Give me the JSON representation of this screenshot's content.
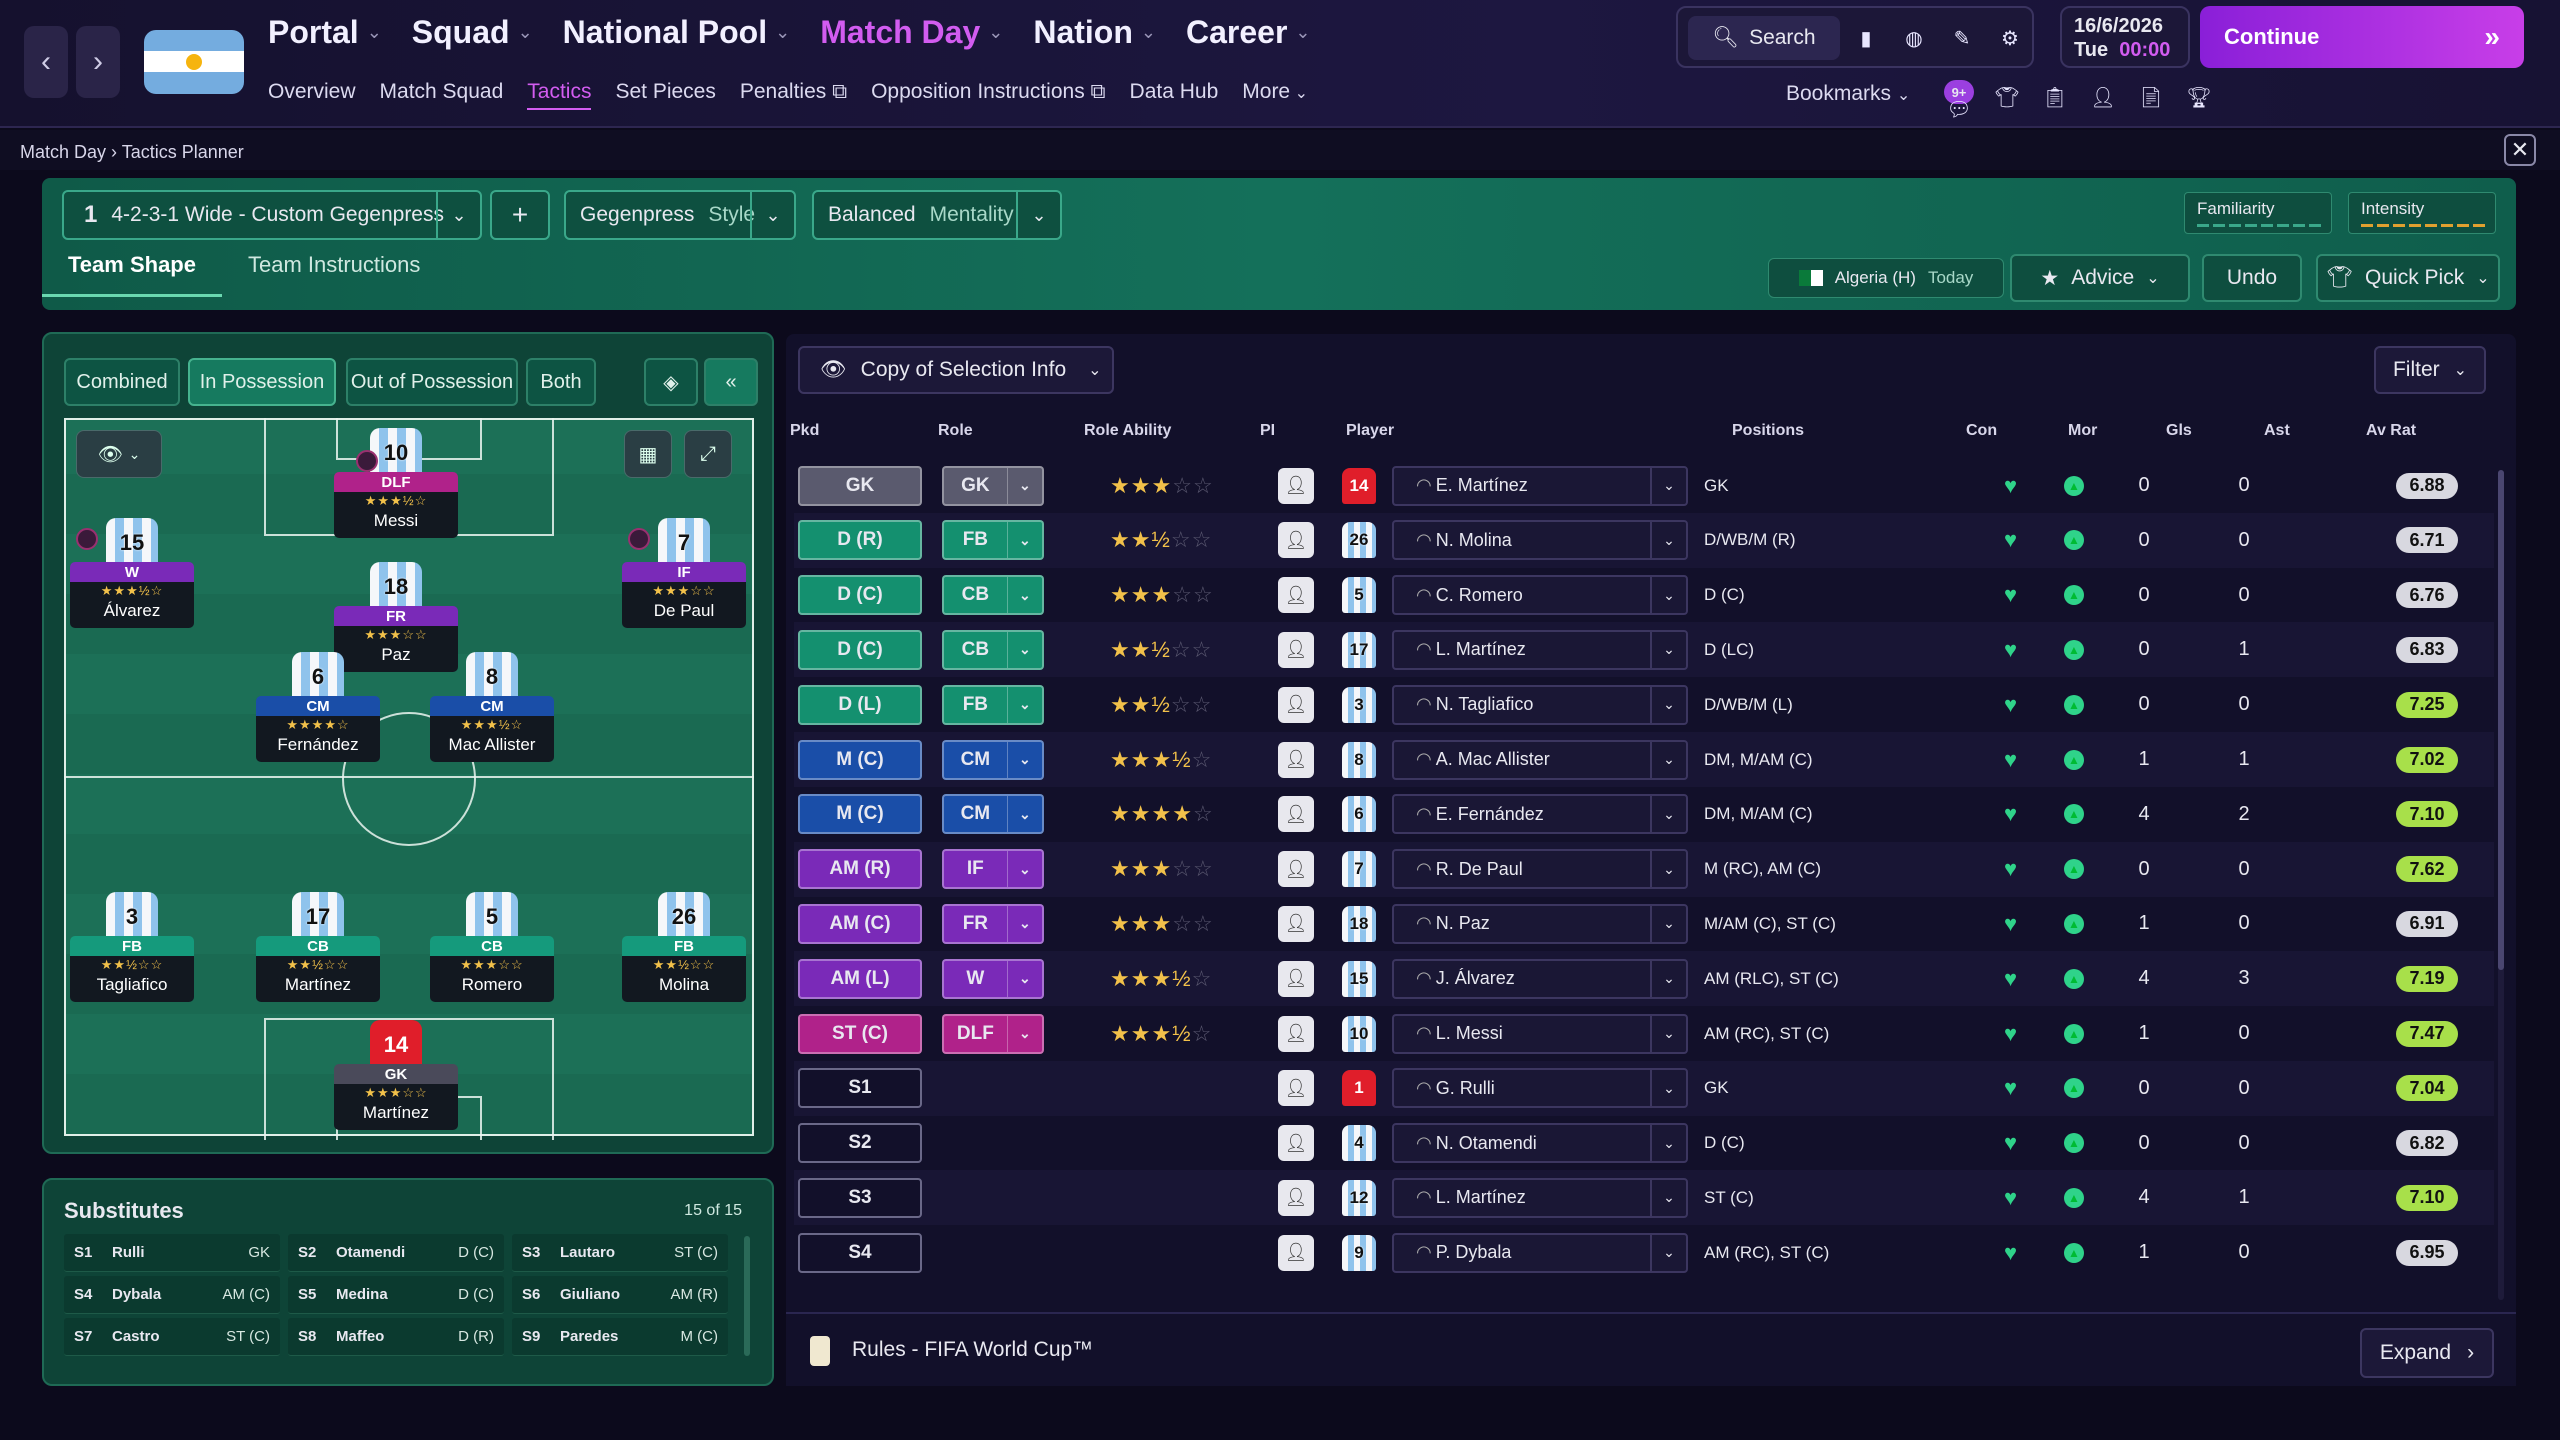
{
  "nav": {
    "back_icon": "chevron-left-icon",
    "forward_icon": "chevron-right-icon",
    "main": [
      {
        "label": "Portal",
        "active": false
      },
      {
        "label": "Squad",
        "active": false
      },
      {
        "label": "National Pool",
        "active": false
      },
      {
        "label": "Match Day",
        "active": true
      },
      {
        "label": "Nation",
        "active": false
      },
      {
        "label": "Career",
        "active": false
      }
    ],
    "sub": [
      "Overview",
      "Match Squad",
      "Tactics",
      "Set Pieces",
      "Penalties",
      "Opposition Instructions",
      "Data Hub",
      "More"
    ],
    "sub_active": "Tactics"
  },
  "toolbar": {
    "search_label": "Search",
    "date": "16/6/2026",
    "day": "Tue",
    "time": "00:00",
    "continue_label": "Continue",
    "bookmarks_label": "Bookmarks",
    "notification_count": "9+"
  },
  "breadcrumb": {
    "parent": "Match Day",
    "current": "Tactics Planner"
  },
  "tactic": {
    "slot": "1",
    "name": "4-2-3-1 Wide - Custom Gegenpress",
    "add_label": "+",
    "style_value": "Gegenpress",
    "style_label": "Style",
    "mentality_value": "Balanced",
    "mentality_label": "Mentality",
    "familiarity_label": "Familiarity",
    "intensity_label": "Intensity"
  },
  "tabs": {
    "team_shape": "Team Shape",
    "team_instructions": "Team Instructions"
  },
  "opponent": {
    "name": "Algeria (H)",
    "when": "Today"
  },
  "actions": {
    "advice": "Advice",
    "undo": "Undo",
    "quick_pick": "Quick Pick"
  },
  "pitch_tabs": [
    "Combined",
    "In Possession",
    "Out of Possession",
    "Both"
  ],
  "pitch_tab_active": "In Possession",
  "pitch_players": [
    {
      "num": "10",
      "role": "DLF",
      "stars": "★★★½☆",
      "name": "Messi",
      "color": "#b0228a",
      "gk": false
    },
    {
      "num": "15",
      "role": "W",
      "stars": "★★★½☆",
      "name": "Álvarez",
      "color": "#7a2ab8",
      "gk": false
    },
    {
      "num": "7",
      "role": "IF",
      "stars": "★★★☆☆",
      "name": "De Paul",
      "color": "#7a2ab8",
      "gk": false
    },
    {
      "num": "18",
      "role": "FR",
      "stars": "★★★☆☆",
      "name": "Paz",
      "color": "#7a2ab8",
      "gk": false
    },
    {
      "num": "6",
      "role": "CM",
      "stars": "★★★★☆",
      "name": "Fernández",
      "color": "#1a4ea8",
      "gk": false
    },
    {
      "num": "8",
      "role": "CM",
      "stars": "★★★½☆",
      "name": "Mac Allister",
      "color": "#1a4ea8",
      "gk": false
    },
    {
      "num": "3",
      "role": "FB",
      "stars": "★★½☆☆",
      "name": "Tagliafico",
      "color": "#159a7c",
      "gk": false
    },
    {
      "num": "17",
      "role": "CB",
      "stars": "★★½☆☆",
      "name": "Martínez",
      "color": "#159a7c",
      "gk": false
    },
    {
      "num": "5",
      "role": "CB",
      "stars": "★★★☆☆",
      "name": "Romero",
      "color": "#159a7c",
      "gk": false
    },
    {
      "num": "26",
      "role": "FB",
      "stars": "★★½☆☆",
      "name": "Molina",
      "color": "#159a7c",
      "gk": false
    },
    {
      "num": "14",
      "role": "GK",
      "stars": "★★★☆☆",
      "name": "Martínez",
      "color": "#4a4a5a",
      "gk": true
    }
  ],
  "substitutes": {
    "title": "Substitutes",
    "count": "15 of 15",
    "items": [
      {
        "slot": "S1",
        "name": "Rulli",
        "pos": "GK"
      },
      {
        "slot": "S2",
        "name": "Otamendi",
        "pos": "D (C)"
      },
      {
        "slot": "S3",
        "name": "Lautaro",
        "pos": "ST (C)"
      },
      {
        "slot": "S4",
        "name": "Dybala",
        "pos": "AM (C)"
      },
      {
        "slot": "S5",
        "name": "Medina",
        "pos": "D (C)"
      },
      {
        "slot": "S6",
        "name": "Giuliano",
        "pos": "AM (R)"
      },
      {
        "slot": "S7",
        "name": "Castro",
        "pos": "ST (C)"
      },
      {
        "slot": "S8",
        "name": "Maffeo",
        "pos": "D (R)"
      },
      {
        "slot": "S9",
        "name": "Paredes",
        "pos": "M (C)"
      }
    ]
  },
  "table": {
    "copy_label": "Copy of Selection Info",
    "filter_label": "Filter",
    "headers": [
      "Pkd",
      "Role",
      "Role Ability",
      "PI",
      "Player",
      "Positions",
      "Con",
      "Mor",
      "Gls",
      "Ast",
      "Av Rat"
    ],
    "rows": [
      {
        "pkd": "GK",
        "role": "GK",
        "stars": "★★★☆☆",
        "num": "14",
        "gk": true,
        "player": "E. Martínez",
        "positions": "GK",
        "gls": "0",
        "ast": "0",
        "rat": "6.88",
        "color": "#5a5a6e",
        "ratcolor": "#d8d8e0"
      },
      {
        "pkd": "D (R)",
        "role": "FB",
        "stars": "★★½☆☆",
        "num": "26",
        "gk": false,
        "player": "N. Molina",
        "positions": "D/WB/M (R)",
        "gls": "0",
        "ast": "0",
        "rat": "6.71",
        "color": "#14906f",
        "ratcolor": "#d8d8e0"
      },
      {
        "pkd": "D (C)",
        "role": "CB",
        "stars": "★★★☆☆",
        "num": "5",
        "gk": false,
        "player": "C. Romero",
        "positions": "D (C)",
        "gls": "0",
        "ast": "0",
        "rat": "6.76",
        "color": "#14906f",
        "ratcolor": "#d8d8e0"
      },
      {
        "pkd": "D (C)",
        "role": "CB",
        "stars": "★★½☆☆",
        "num": "17",
        "gk": false,
        "player": "L. Martínez",
        "positions": "D (LC)",
        "gls": "0",
        "ast": "1",
        "rat": "6.83",
        "color": "#14906f",
        "ratcolor": "#d8d8e0"
      },
      {
        "pkd": "D (L)",
        "role": "FB",
        "stars": "★★½☆☆",
        "num": "3",
        "gk": false,
        "player": "N. Tagliafico",
        "positions": "D/WB/M (L)",
        "gls": "0",
        "ast": "0",
        "rat": "7.25",
        "color": "#14906f",
        "ratcolor": "#a8e04a"
      },
      {
        "pkd": "M (C)",
        "role": "CM",
        "stars": "★★★½☆",
        "num": "8",
        "gk": false,
        "player": "A. Mac Allister",
        "positions": "DM, M/AM (C)",
        "gls": "1",
        "ast": "1",
        "rat": "7.02",
        "color": "#1a4ea8",
        "ratcolor": "#a8e04a"
      },
      {
        "pkd": "M (C)",
        "role": "CM",
        "stars": "★★★★☆",
        "num": "6",
        "gk": false,
        "player": "E. Fernández",
        "positions": "DM, M/AM (C)",
        "gls": "4",
        "ast": "2",
        "rat": "7.10",
        "color": "#1a4ea8",
        "ratcolor": "#a8e04a"
      },
      {
        "pkd": "AM (R)",
        "role": "IF",
        "stars": "★★★☆☆",
        "num": "7",
        "gk": false,
        "player": "R. De Paul",
        "positions": "M (RC), AM (C)",
        "gls": "0",
        "ast": "0",
        "rat": "7.62",
        "color": "#7a2ab8",
        "ratcolor": "#a8e04a"
      },
      {
        "pkd": "AM (C)",
        "role": "FR",
        "stars": "★★★☆☆",
        "num": "18",
        "gk": false,
        "player": "N. Paz",
        "positions": "M/AM (C), ST (C)",
        "gls": "1",
        "ast": "0",
        "rat": "6.91",
        "color": "#7a2ab8",
        "ratcolor": "#d8d8e0"
      },
      {
        "pkd": "AM (L)",
        "role": "W",
        "stars": "★★★½☆",
        "num": "15",
        "gk": false,
        "player": "J. Álvarez",
        "positions": "AM (RLC), ST (C)",
        "gls": "4",
        "ast": "3",
        "rat": "7.19",
        "color": "#7a2ab8",
        "ratcolor": "#a8e04a"
      },
      {
        "pkd": "ST (C)",
        "role": "DLF",
        "stars": "★★★½☆",
        "num": "10",
        "gk": false,
        "player": "L. Messi",
        "positions": "AM (RC), ST (C)",
        "gls": "1",
        "ast": "0",
        "rat": "7.47",
        "color": "#b0228a",
        "ratcolor": "#a8e04a"
      },
      {
        "pkd": "S1",
        "role": "",
        "stars": "",
        "num": "1",
        "gk": true,
        "player": "G. Rulli",
        "positions": "GK",
        "gls": "0",
        "ast": "0",
        "rat": "7.04",
        "color": "",
        "ratcolor": "#a8e04a"
      },
      {
        "pkd": "S2",
        "role": "",
        "stars": "",
        "num": "4",
        "gk": false,
        "player": "N. Otamendi",
        "positions": "D (C)",
        "gls": "0",
        "ast": "0",
        "rat": "6.82",
        "color": "",
        "ratcolor": "#d8d8e0"
      },
      {
        "pkd": "S3",
        "role": "",
        "stars": "",
        "num": "12",
        "gk": false,
        "player": "L. Martínez",
        "positions": "ST (C)",
        "gls": "4",
        "ast": "1",
        "rat": "7.10",
        "color": "",
        "ratcolor": "#a8e04a"
      },
      {
        "pkd": "S4",
        "role": "",
        "stars": "",
        "num": "9",
        "gk": false,
        "player": "P. Dybala",
        "positions": "AM (RC), ST (C)",
        "gls": "1",
        "ast": "0",
        "rat": "6.95",
        "color": "",
        "ratcolor": "#d8d8e0"
      }
    ]
  },
  "rules": {
    "label": "Rules - FIFA World Cup™",
    "expand_label": "Expand"
  }
}
